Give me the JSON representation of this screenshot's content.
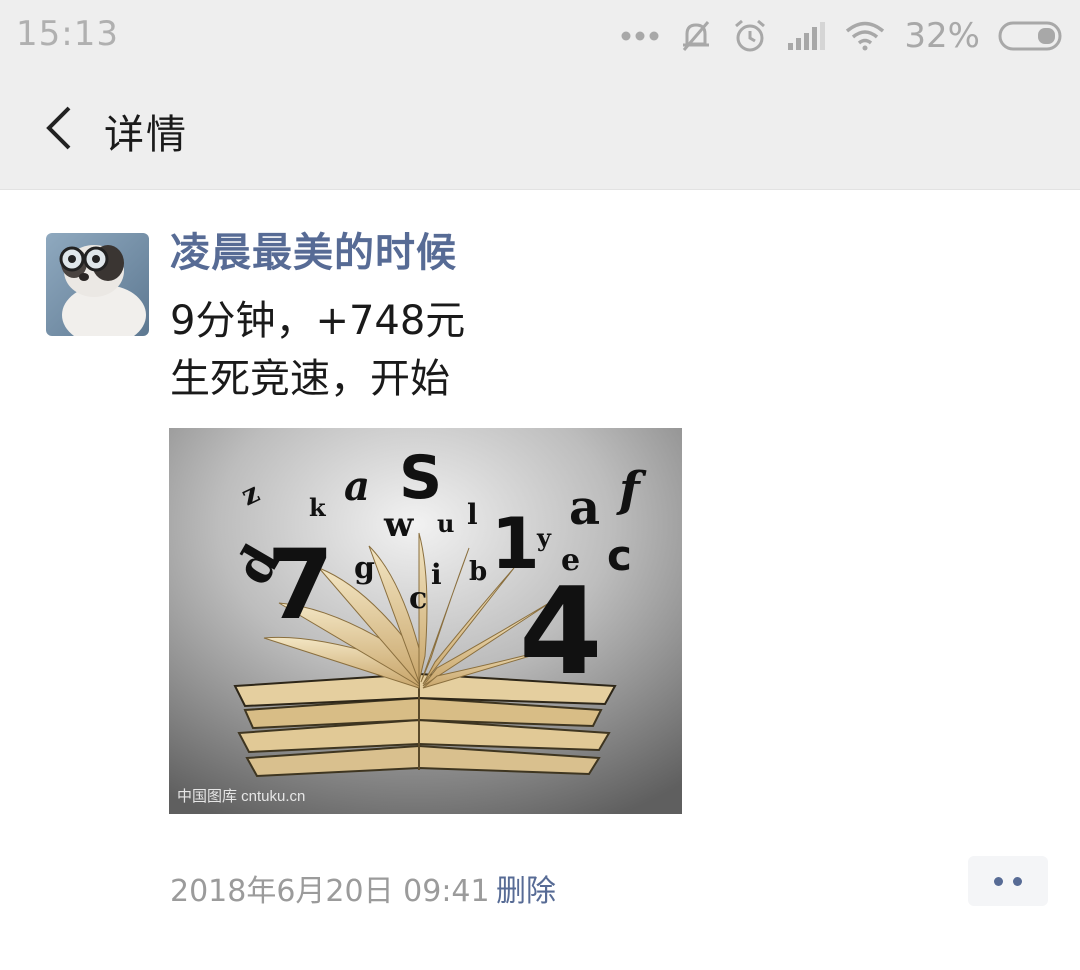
{
  "status_bar": {
    "time": "15:13",
    "battery": "32%",
    "icons": [
      "more-dots-icon",
      "mute-icon",
      "alarm-icon",
      "signal-icon",
      "wifi-icon",
      "battery-icon"
    ]
  },
  "nav": {
    "title": "详情",
    "back_icon": "chevron-left-icon"
  },
  "post": {
    "author": "凌晨最美的时候",
    "text_lines": [
      "9分钟，+748元",
      "生死竞速，开始"
    ],
    "image": {
      "watermark": "中国图库 cntuku.cn",
      "glyphs": [
        "z",
        "k",
        "a",
        "S",
        "a",
        "f",
        "d",
        "7",
        "w",
        "u",
        "l",
        "1",
        "y",
        "e",
        "c",
        "g",
        "i",
        "b",
        "c",
        "4"
      ]
    },
    "timestamp": "2018年6月20日 09:41",
    "delete_label": "删除"
  },
  "colors": {
    "link": "#576b95",
    "bar_bg": "#eeeeee"
  }
}
